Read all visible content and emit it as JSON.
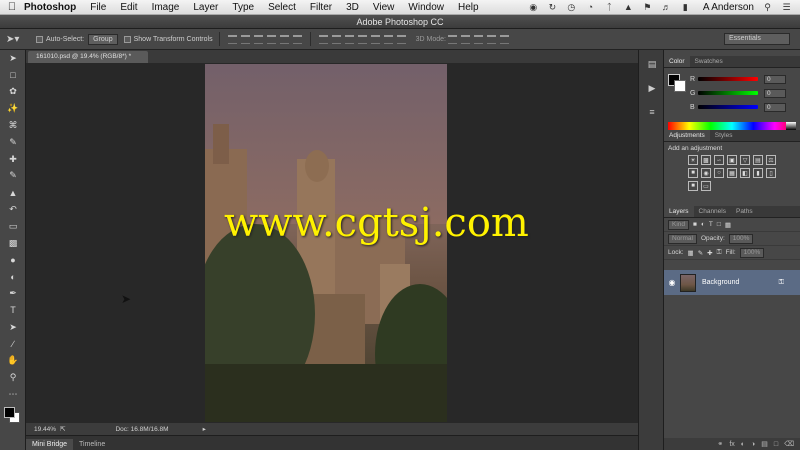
{
  "menubar": {
    "app_name": "Photoshop",
    "items": [
      "File",
      "Edit",
      "Image",
      "Layer",
      "Type",
      "Select",
      "Filter",
      "3D",
      "View",
      "Window",
      "Help"
    ],
    "user": "A Anderson"
  },
  "window": {
    "title": "Adobe Photoshop CC"
  },
  "options_bar": {
    "auto_select_label": "Auto-Select:",
    "auto_select_value": "Group",
    "show_transform_label": "Show Transform Controls",
    "mode_3d_label": "3D Mode:",
    "workspace": "Essentials"
  },
  "document": {
    "tab_label": "161010.psd @ 19.4% (RGB/8*) *",
    "zoom": "19.44%",
    "doc_info": "Doc: 16.8M/16.8M"
  },
  "bottom_tabs": [
    "Mini Bridge",
    "Timeline"
  ],
  "color_panel": {
    "tabs": [
      "Color",
      "Swatches"
    ],
    "channels": [
      {
        "name": "R",
        "value": "0",
        "color": "#ff0000"
      },
      {
        "name": "G",
        "value": "0",
        "color": "#00ff00"
      },
      {
        "name": "B",
        "value": "0",
        "color": "#0000ff"
      }
    ]
  },
  "adjustments_panel": {
    "tabs": [
      "Adjustments",
      "Styles"
    ],
    "title": "Add an adjustment"
  },
  "layers_panel": {
    "tabs": [
      "Layers",
      "Channels",
      "Paths"
    ],
    "filter_kind": "Kind",
    "blend_mode": "Normal",
    "opacity_label": "Opacity:",
    "opacity_value": "100%",
    "lock_label": "Lock:",
    "fill_label": "Fill:",
    "fill_value": "100%",
    "layer_name": "Background"
  },
  "watermark": "www.cgtsj.com",
  "colors": {
    "selected_layer": "#5b6b85",
    "watermark": "#fff200"
  }
}
